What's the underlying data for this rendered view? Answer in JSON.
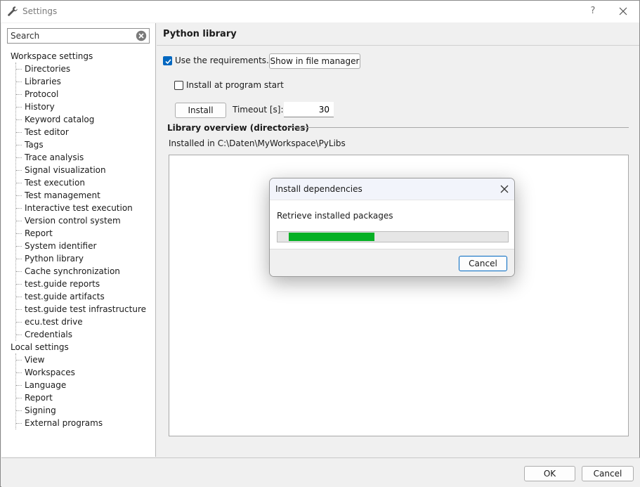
{
  "window": {
    "title": "Settings",
    "help_label": "?",
    "icon": "wrench-icon",
    "close_icon": "close-icon"
  },
  "sidebar": {
    "search_placeholder": "Search",
    "search_value": "",
    "groups": [
      {
        "label": "Workspace settings",
        "items": [
          "Directories",
          "Libraries",
          "Protocol",
          "History",
          "Keyword catalog",
          "Test editor",
          "Tags",
          "Trace analysis",
          "Signal visualization",
          "Test execution",
          "Test management",
          "Interactive test execution",
          "Version control system",
          "Report",
          "System identifier",
          "Python library",
          "Cache synchronization",
          "test.guide reports",
          "test.guide artifacts",
          "test.guide test infrastructure",
          "ecu.test drive",
          "Credentials"
        ]
      },
      {
        "label": "Local settings",
        "items": [
          "View",
          "Workspaces",
          "Language",
          "Report",
          "Signing",
          "External programs"
        ]
      }
    ]
  },
  "main": {
    "title": "Python library",
    "use_requirements_label": "Use the requirements.txt",
    "use_requirements_checked": true,
    "show_in_file_manager_label": "Show in file manager",
    "install_at_start_label": "Install at program start",
    "install_at_start_checked": false,
    "install_label": "Install",
    "timeout_label": "Timeout [s]:",
    "timeout_value": "30",
    "section_title": "Library overview (directories)",
    "installed_path": "Installed in C:\\Daten\\MyWorkspace\\PyLibs"
  },
  "footer": {
    "ok_label": "OK",
    "cancel_label": "Cancel"
  },
  "dialog": {
    "title": "Install dependencies",
    "status": "Retrieve installed packages",
    "progress_fraction": 0.39,
    "progress_color": "#06b025",
    "cancel_label": "Cancel"
  },
  "colors": {
    "accent": "#0067c0"
  }
}
